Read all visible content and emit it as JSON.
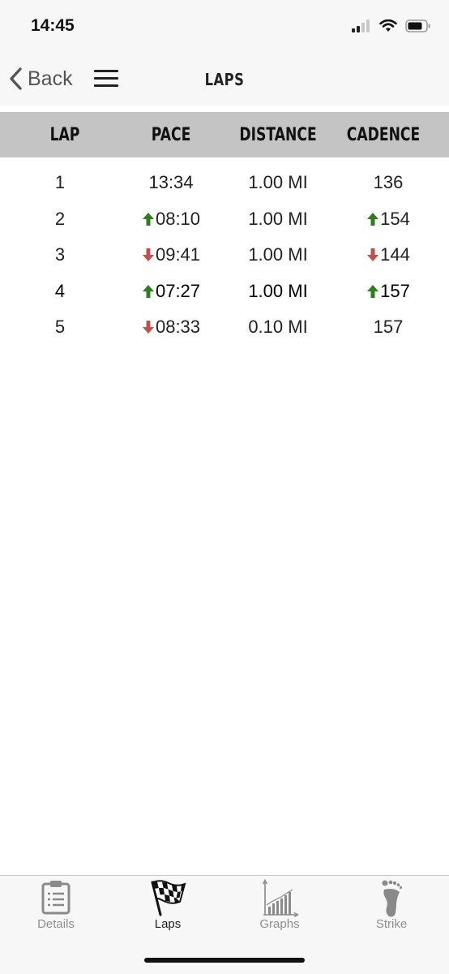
{
  "status_bar": {
    "time": "14:45"
  },
  "nav": {
    "back_label": "Back",
    "title": "LAPS"
  },
  "table": {
    "headers": {
      "lap": "LAP",
      "pace": "PACE",
      "distance": "DISTANCE",
      "cadence": "CADENCE"
    },
    "rows": [
      {
        "lap": "1",
        "pace": "13:34",
        "pace_trend": "none",
        "distance": "1.00 MI",
        "cadence": "136",
        "cadence_trend": "none",
        "bold": false
      },
      {
        "lap": "2",
        "pace": "08:10",
        "pace_trend": "up",
        "distance": "1.00 MI",
        "cadence": "154",
        "cadence_trend": "up",
        "bold": false
      },
      {
        "lap": "3",
        "pace": "09:41",
        "pace_trend": "down",
        "distance": "1.00 MI",
        "cadence": "144",
        "cadence_trend": "down",
        "bold": false
      },
      {
        "lap": "4",
        "pace": "07:27",
        "pace_trend": "up",
        "distance": "1.00 MI",
        "cadence": "157",
        "cadence_trend": "up",
        "bold": true
      },
      {
        "lap": "5",
        "pace": "08:33",
        "pace_trend": "down",
        "distance": "0.10 MI",
        "cadence": "157",
        "cadence_trend": "none",
        "bold": false
      }
    ]
  },
  "tabs": [
    {
      "label": "Details",
      "icon": "clipboard-icon",
      "active": false
    },
    {
      "label": "Laps",
      "icon": "checkered-flag-icon",
      "active": true
    },
    {
      "label": "Graphs",
      "icon": "bar-graph-icon",
      "active": false
    },
    {
      "label": "Strike",
      "icon": "footprint-icon",
      "active": false
    }
  ],
  "colors": {
    "up_arrow": "#2e7d1e",
    "down_arrow": "#c0504d",
    "header_bg": "#c4c4c4"
  }
}
